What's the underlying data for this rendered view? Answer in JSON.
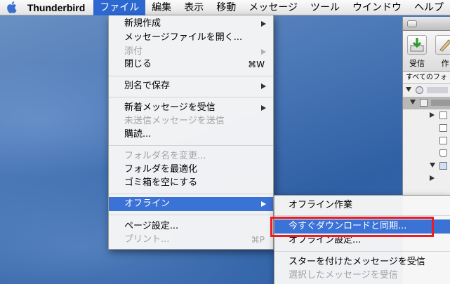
{
  "menubar": {
    "app_name": "Thunderbird",
    "menus": [
      "ファイル",
      "編集",
      "表示",
      "移動",
      "メッセージ",
      "ツール",
      "ウインドウ",
      "ヘルプ"
    ]
  },
  "file_menu": {
    "items": [
      {
        "label": "新規作成",
        "submenu": true,
        "enabled": true
      },
      {
        "label": "メッセージファイルを開く...",
        "enabled": true
      },
      {
        "label": "添付",
        "submenu": true,
        "enabled": false
      },
      {
        "label": "閉じる",
        "shortcut": "⌘W",
        "enabled": true
      },
      {
        "label": "別名で保存",
        "submenu": true,
        "enabled": true
      },
      {
        "label": "新着メッセージを受信",
        "submenu": true,
        "enabled": true
      },
      {
        "label": "未送信メッセージを送信",
        "enabled": false
      },
      {
        "label": "購読...",
        "enabled": true
      },
      {
        "label": "フォルダ名を変更...",
        "enabled": false
      },
      {
        "label": "フォルダを最適化",
        "enabled": true
      },
      {
        "label": "ゴミ箱を空にする",
        "enabled": true
      },
      {
        "label": "オフライン",
        "submenu": true,
        "enabled": true,
        "highlighted": true
      },
      {
        "label": "ページ設定...",
        "enabled": true
      },
      {
        "label": "プリント...",
        "shortcut": "⌘P",
        "enabled": false
      }
    ]
  },
  "offline_submenu": {
    "items": [
      {
        "label": "オフライン作業",
        "enabled": true
      },
      {
        "label": "今すぐダウンロードと同期...",
        "enabled": true,
        "highlighted": true
      },
      {
        "label": "オフライン設定...",
        "enabled": true
      },
      {
        "label": "スターを付けたメッセージを受信",
        "enabled": true
      },
      {
        "label": "選択したメッセージを受信",
        "enabled": false
      }
    ]
  },
  "background_window": {
    "toolbar_get_mail": "受信",
    "toolbar_write": "作",
    "folders_header": "すべてのフォ"
  },
  "colors": {
    "highlight": "#3a72d6",
    "annotation": "#ec1c24"
  }
}
